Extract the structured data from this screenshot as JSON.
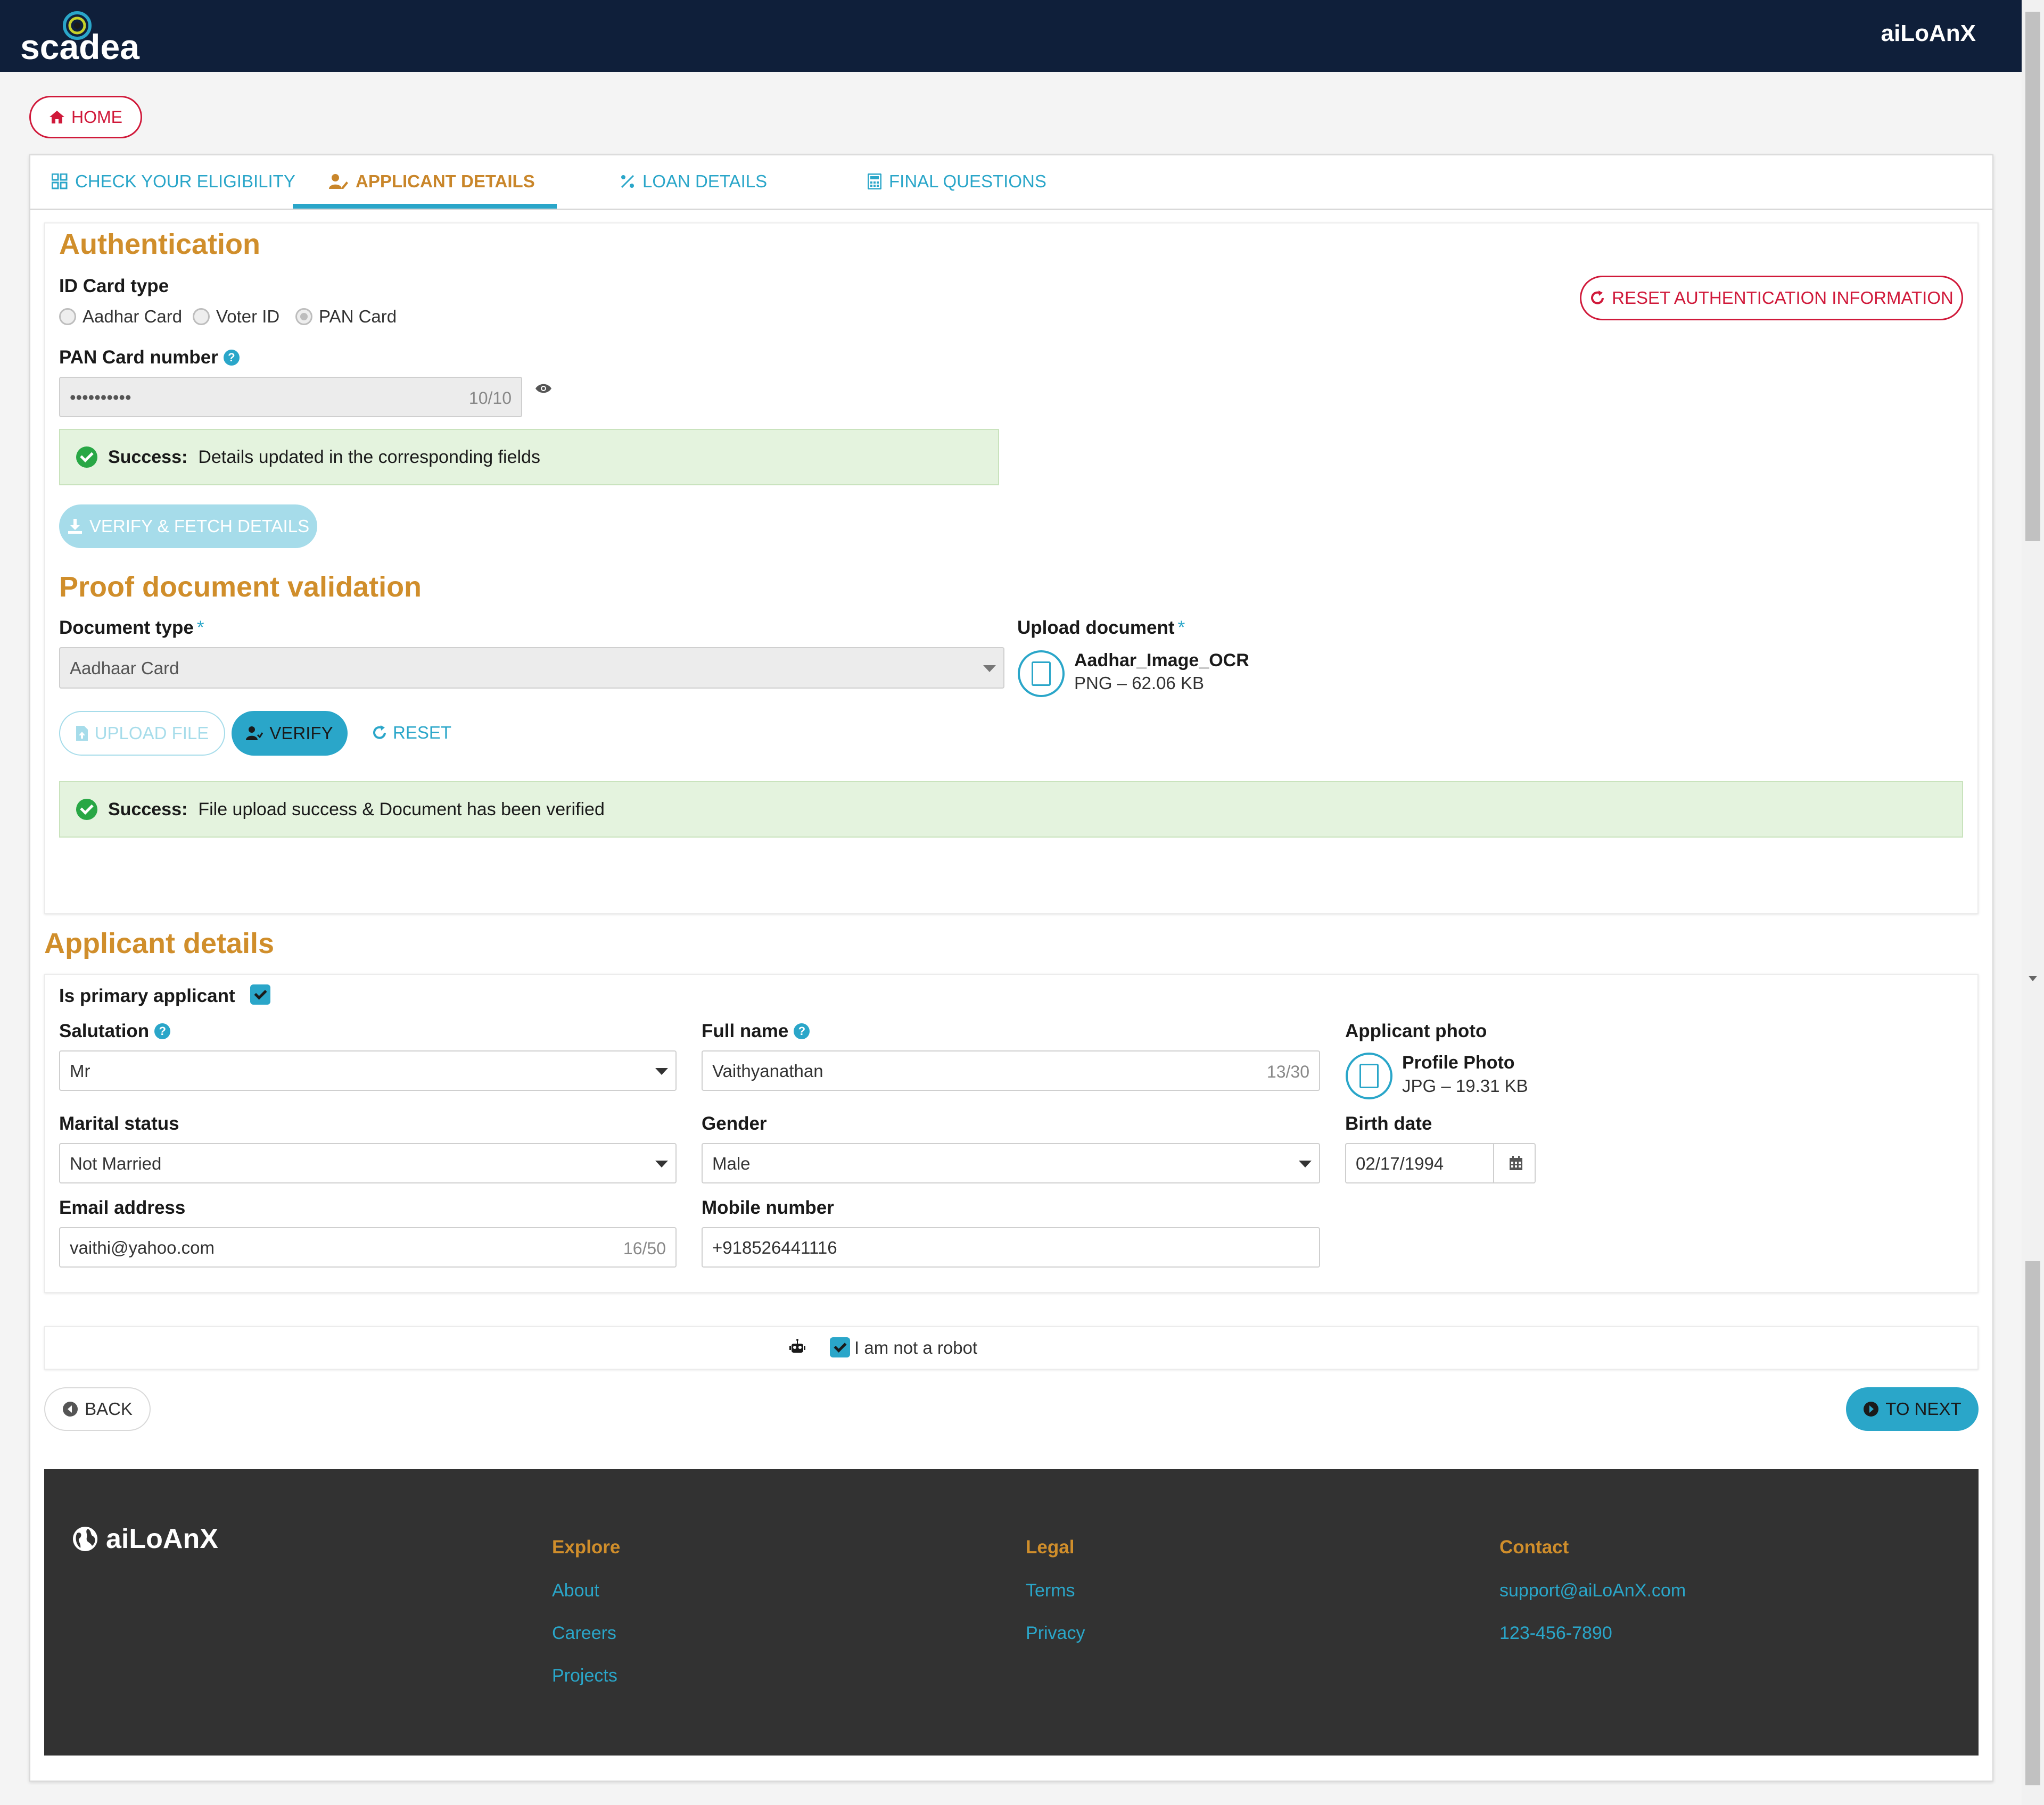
{
  "header": {
    "logo_text": "scadea",
    "app_name": "aiLoAnX"
  },
  "home_button": {
    "label": "HOME",
    "icon": "home-icon"
  },
  "tabs": [
    {
      "label": "CHECK YOUR ELIGIBILITY",
      "icon": "grid-icon"
    },
    {
      "label": "APPLICANT DETAILS",
      "icon": "user-edit-icon",
      "active": true
    },
    {
      "label": "LOAN DETAILS",
      "icon": "percent-icon"
    },
    {
      "label": "FINAL QUESTIONS",
      "icon": "calculator-icon"
    }
  ],
  "authentication": {
    "title": "Authentication",
    "id_card_type_label": "ID Card type",
    "options": [
      "Aadhar Card",
      "Voter ID",
      "PAN Card"
    ],
    "selected": "PAN Card",
    "reset_button": "RESET AUTHENTICATION INFORMATION",
    "pan_label": "PAN Card number",
    "pan_value": "••••••••••",
    "pan_counter": "10/10",
    "alert_strong": "Success:",
    "alert_text": "Details updated in the corresponding fields",
    "verify_fetch_button": "VERIFY & FETCH DETAILS"
  },
  "proof": {
    "title": "Proof document validation",
    "doc_type_label": "Document type",
    "doc_type_value": "Aadhaar Card",
    "upload_label": "Upload document",
    "required_mark": "*",
    "file_name": "Aadhar_Image_OCR",
    "file_meta": "PNG – 62.06 KB",
    "upload_button": "UPLOAD FILE",
    "verify_button": "VERIFY",
    "reset_button": "RESET",
    "alert_strong": "Success:",
    "alert_text": "File upload success & Document has been verified"
  },
  "applicant": {
    "title": "Applicant details",
    "primary_label": "Is primary applicant",
    "primary_checked": true,
    "salutation_label": "Salutation",
    "salutation_value": "Mr",
    "fullname_label": "Full name",
    "fullname_value": "Vaithyanathan",
    "fullname_counter": "13/30",
    "photo_label": "Applicant photo",
    "photo_name": "Profile Photo",
    "photo_meta": "JPG – 19.31 KB",
    "marital_label": "Marital status",
    "marital_value": "Not Married",
    "gender_label": "Gender",
    "gender_value": "Male",
    "birth_label": "Birth date",
    "birth_value": "02/17/1994",
    "email_label": "Email address",
    "email_value": "vaithi@yahoo.com",
    "email_counter": "16/50",
    "mobile_label": "Mobile number",
    "mobile_value": "+918526441116"
  },
  "captcha": {
    "label": "I am not a robot",
    "checked": true
  },
  "nav": {
    "back": "BACK",
    "next": "TO NEXT"
  },
  "footer": {
    "brand": "aiLoAnX",
    "explore": {
      "title": "Explore",
      "links": [
        "About",
        "Careers",
        "Projects"
      ]
    },
    "legal": {
      "title": "Legal",
      "links": [
        "Terms",
        "Privacy"
      ]
    },
    "contact": {
      "title": "Contact",
      "links": [
        "support@aiLoAnX.com",
        "123-456-7890"
      ]
    }
  },
  "colors": {
    "navy": "#0f1f3a",
    "accent": "#2aa6c9",
    "heading": "#d08e2b",
    "danger": "#d0193a",
    "success": "#28a745"
  }
}
